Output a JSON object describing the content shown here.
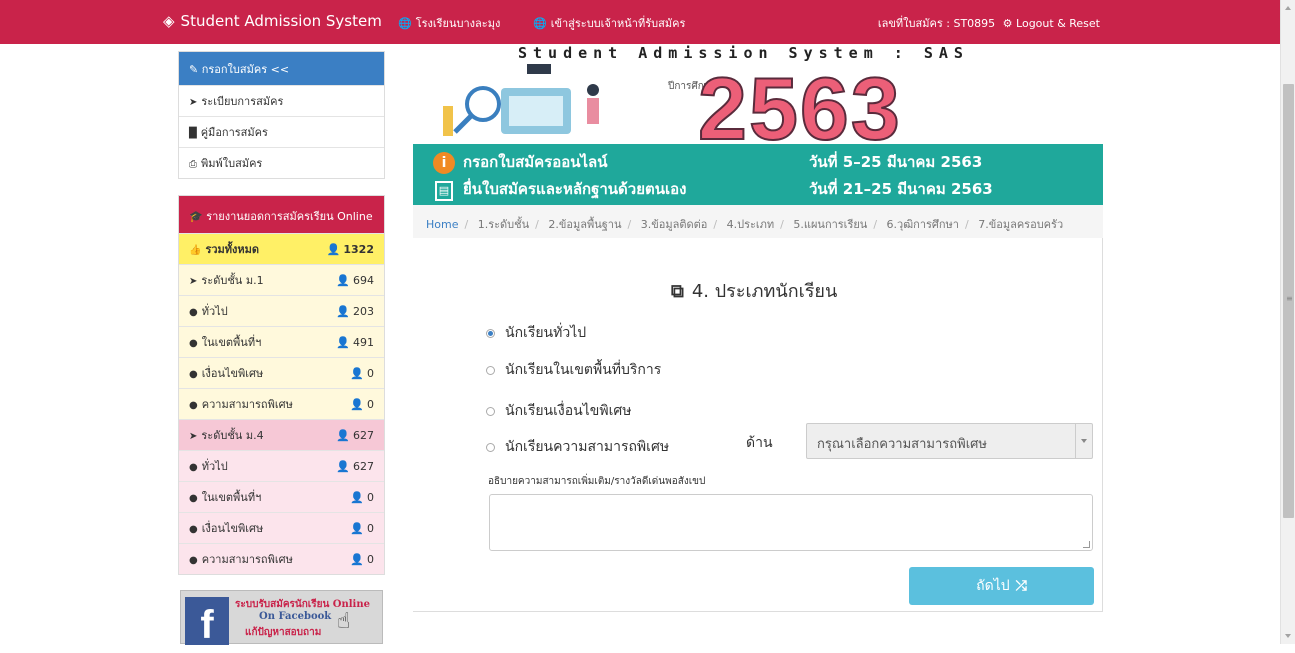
{
  "navbar": {
    "brand": "Student Admission System",
    "link1": "โรงเรียนบางละมุง",
    "link2": "เข้าสู่ระบบเจ้าหน้าที่รับสมัคร",
    "applicant": "เลขที่ใบสมัคร : ST0895",
    "logout": "Logout & Reset",
    "color": "#c9234a"
  },
  "sidebar": {
    "apply_head": "กรอกใบสมัคร <<",
    "apply_items": [
      "ระเบียบการสมัคร",
      "คู่มือการสมัคร",
      "พิมพ์ใบสมัคร"
    ],
    "report_head": "รายงานยอดการสมัครเรียน Online",
    "stats": [
      {
        "label": "รวมทั้งหมด",
        "count": "1322"
      },
      {
        "label": "ระดับชั้น ม.1",
        "count": "694"
      },
      {
        "label": "ทั่วไป",
        "count": "203"
      },
      {
        "label": "ในเขตพื้นที่ฯ",
        "count": "491"
      },
      {
        "label": "เงื่อนไขพิเศษ",
        "count": "0"
      },
      {
        "label": "ความสามารถพิเศษ",
        "count": "0"
      },
      {
        "label": "ระดับชั้น ม.4",
        "count": "627"
      },
      {
        "label": "ทั่วไป",
        "count": "627"
      },
      {
        "label": "ในเขตพื้นที่ฯ",
        "count": "0"
      },
      {
        "label": "เงื่อนไขพิเศษ",
        "count": "0"
      },
      {
        "label": "ความสามารถพิเศษ",
        "count": "0"
      }
    ],
    "facebook": {
      "line1": "ระบบรับสมัครนักเรียน Online",
      "line2": "On Facebook",
      "line3": "แก้ปัญหาสอบถาม"
    }
  },
  "banner": {
    "title": "Student Admission System : SAS",
    "academic_year_label": "ปีการศึกษา",
    "year": "2563",
    "line1": "กรอกใบสมัครออนไลน์",
    "line1_date": "วันที่ 5–25 มีนาคม 2563",
    "line2": "ยื่นใบสมัครและหลักฐานด้วยตนเอง",
    "line2_date": "วันที่ 21–25 มีนาคม 2563"
  },
  "breadcrumb": [
    "Home",
    "1.ระดับชั้น",
    "2.ข้อมูลพื้นฐาน",
    "3.ข้อมูลติดต่อ",
    "4.ประเภท",
    "5.แผนการเรียน",
    "6.วุฒิการศึกษา",
    "7.ข้อมูลครอบครัว"
  ],
  "form": {
    "heading": "4. ประเภทนักเรียน",
    "options": [
      "นักเรียนทั่วไป",
      "นักเรียนในเขตพื้นที่บริการ",
      "นักเรียนเงื่อนไขพิเศษ",
      "นักเรียนความสามารถพิเศษ"
    ],
    "selected_option": "นักเรียนทั่วไป",
    "side_label": "ด้าน",
    "select_placeholder": "กรุณาเลือกความสามารถพิเศษ",
    "textarea_label": "อธิบายความสามารถเพิ่มเติม/รางวัลดีเด่นพอสังเขป",
    "textarea_value": "",
    "next_button": "ถัดไป"
  }
}
